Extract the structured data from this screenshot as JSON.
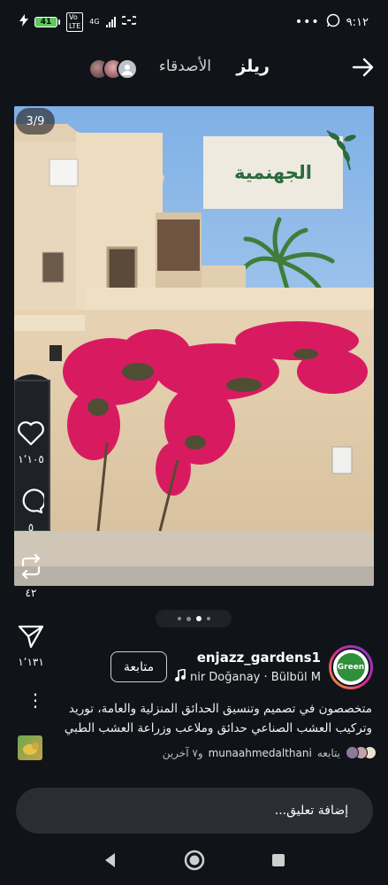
{
  "status_bar": {
    "time": "٩:١٢",
    "battery": "41",
    "network": "4G",
    "volte": "Vo LTE"
  },
  "header": {
    "tab_reels": "ريلز",
    "tab_friends": "الأصدقاء"
  },
  "reel": {
    "counter": "3/9",
    "overlay_title": "الجهنمية"
  },
  "actions": {
    "likes": "١٬١٠٥",
    "comments": "٥",
    "reposts": "٤٢",
    "shares": "١٬١٣١"
  },
  "pagination": {
    "count": 4,
    "active_index": 2
  },
  "author": {
    "username": "enjazz_gardens1",
    "avatar_logo_text": "Green",
    "music": "nir Doğanay · Bülbül  M",
    "follow_label": "متابعة"
  },
  "caption": {
    "line1": "متخصصون في تصميم وتنسيق الحدائق المنزلية والعامة، توريد",
    "line2": "وتركيب العشب الصناعي حدائق وملاعب وزراعة العشب الطبي ..."
  },
  "followers": {
    "prefix": "يتابعه",
    "name": "munaahmedalthani",
    "suffix": "و٧ آخرين"
  },
  "comment_input": {
    "placeholder": "إضافة تعليق..."
  },
  "colors": {
    "background": "#101418",
    "tag_text": "#2a6a3c",
    "bougainvillea": "#d81b60"
  },
  "icons": [
    "back-icon",
    "home-icon",
    "recents-icon",
    "heart-icon",
    "comment-icon",
    "repost-icon",
    "share-icon",
    "music-note-icon",
    "more-icon",
    "arrow-right-icon"
  ]
}
